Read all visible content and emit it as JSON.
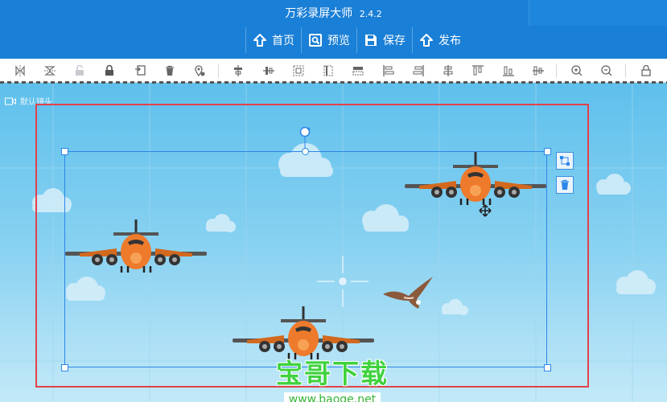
{
  "window": {
    "title": "万彩录屏大师",
    "version": "2.4.2"
  },
  "nav": {
    "items": [
      {
        "label": "首页",
        "icon": "home-icon"
      },
      {
        "label": "预览",
        "icon": "preview-icon"
      },
      {
        "label": "保存",
        "icon": "save-icon"
      },
      {
        "label": "发布",
        "icon": "publish-icon"
      }
    ]
  },
  "toolbar": {
    "icons": [
      "flip-horizontal-icon",
      "flip-vertical-icon",
      "unlock-icon",
      "lock-icon",
      "replace-icon",
      "delete-icon",
      "location-icon",
      "align-left-edge-icon",
      "align-center-icon",
      "group-icon",
      "ungroup-icon",
      "distribute-icon",
      "align-left-icon",
      "align-right-icon",
      "align-top-center-icon",
      "align-top-icon",
      "align-bottom-icon",
      "align-middle-icon",
      "zoom-in-icon",
      "zoom-out-icon",
      "lock-canvas-icon"
    ]
  },
  "canvas": {
    "camera_label": "默认镜头",
    "colors": {
      "frame": "#e2414b",
      "selection": "#2e86e8",
      "sky_top": "#5fc0ec",
      "sky_bottom": "#c3e9f8"
    }
  },
  "watermark": {
    "text": "宝哥下载",
    "url": "www.baoge.net"
  }
}
